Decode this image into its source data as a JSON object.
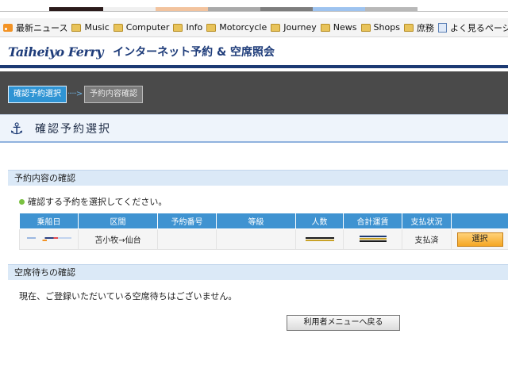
{
  "bookmarks": [
    {
      "label": "最新ニュース",
      "icon": "rss-icon"
    },
    {
      "label": "Music",
      "icon": "folder-icon"
    },
    {
      "label": "Computer",
      "icon": "folder-icon"
    },
    {
      "label": "Info",
      "icon": "folder-icon"
    },
    {
      "label": "Motorcycle",
      "icon": "folder-icon"
    },
    {
      "label": "Journey",
      "icon": "folder-icon"
    },
    {
      "label": "News",
      "icon": "folder-icon"
    },
    {
      "label": "Shops",
      "icon": "folder-icon"
    },
    {
      "label": "庶務",
      "icon": "folder-icon"
    },
    {
      "label": "よく見るページ",
      "icon": "page-icon"
    }
  ],
  "header": {
    "logo_main": "Taiheiyo",
    "logo_ferry": "Ferry",
    "title": "インターネット予約 & 空席照会"
  },
  "steps": {
    "active": "確認予約選択",
    "inactive": "予約内容確認",
    "arrow": "·····>"
  },
  "page_title": "確認予約選択",
  "reservation_section": {
    "heading": "予約内容の確認",
    "note": "確認する予約を選択してください。",
    "columns": [
      "乗船日",
      "区間",
      "予約番号",
      "等級",
      "人数",
      "合計運賃",
      "支払状況",
      ""
    ],
    "rows": [
      {
        "date": "",
        "route": "苫小牧→仙台",
        "number": "",
        "grade": "",
        "people": "",
        "fare": "",
        "status": "支払済",
        "action": "選択"
      }
    ]
  },
  "waitlist_section": {
    "heading": "空席待ちの確認",
    "message": "現在、ご登録いただいている空席待ちはございません。"
  },
  "back_button": "利用者メニューへ戻る",
  "colors": {
    "header_blue": "#1c3a73",
    "table_header": "#3f93d1",
    "select_button": "#f5a623"
  }
}
